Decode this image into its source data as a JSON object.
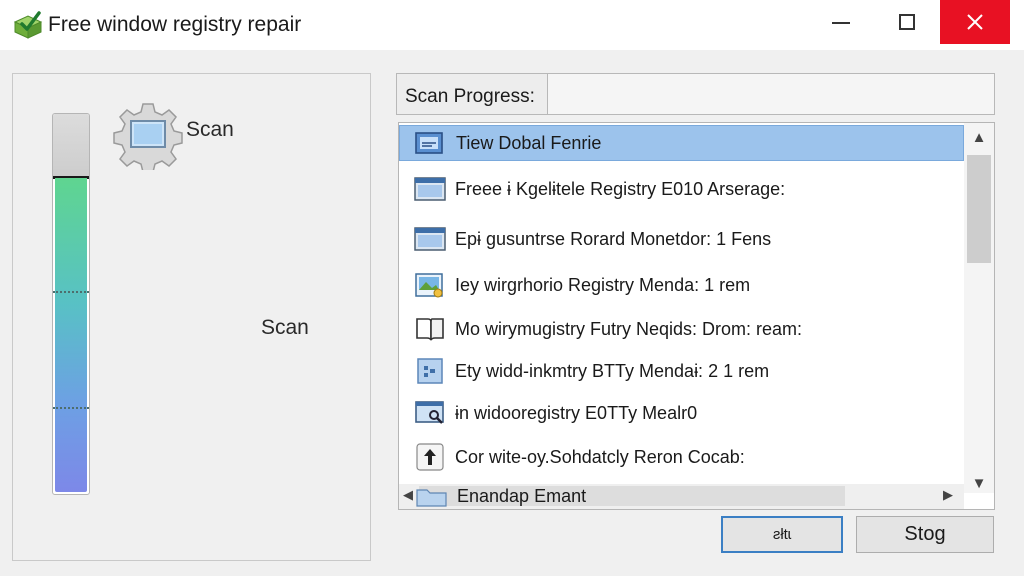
{
  "window": {
    "title": "Free window registry repair",
    "controls": [
      "minimize",
      "maximize",
      "close"
    ],
    "close_color": "#e81123"
  },
  "left_panel": {
    "scan_title": "Scan",
    "scan_label": "Scan",
    "scan_icon": "gear-icon",
    "meter_level": 0.84,
    "meter_colors": [
      "#5fd590",
      "#58c1c5",
      "#6da0e4",
      "#7d88e8"
    ]
  },
  "progress": {
    "label": "Scan Progress:",
    "value": ""
  },
  "list": {
    "items": [
      {
        "text": "Tiew Dobal Fenrie",
        "icon": "window-app-icon",
        "selected": true
      },
      {
        "text": "Freee ɨ Kgelɨtele Registry E010 Arserage:",
        "icon": "window-app-icon",
        "selected": false
      },
      {
        "text": "Epɨ gusuntrse Rorard Monetdor: 1 Fens",
        "icon": "window-app-icon",
        "selected": false
      },
      {
        "text": "Iey wirgrhorio Registry Menda: 1 rem",
        "icon": "picture-icon",
        "selected": false
      },
      {
        "text": "Mo wirymugistry Futry Neqids: Drom: ream:",
        "icon": "book-icon",
        "selected": false
      },
      {
        "text": "Ety widd-inkmtry BTTy Mendaɨ: 2 1 rem",
        "icon": "grid-icon",
        "selected": false
      },
      {
        "text": "ɨn widooregistry E0TTy Mealr0",
        "icon": "screen-search-icon",
        "selected": false
      },
      {
        "text": "Cor wite-oy.Sohdatcly Reron Cocab:",
        "icon": "up-arrow-icon",
        "selected": false
      }
    ],
    "partial_item": {
      "text": "Enandap Emant",
      "icon": "folder-icon"
    },
    "selected_color": "#9cc3ec"
  },
  "buttons": {
    "start_label": "ƨłtɩ",
    "stop_label": "Stog"
  }
}
